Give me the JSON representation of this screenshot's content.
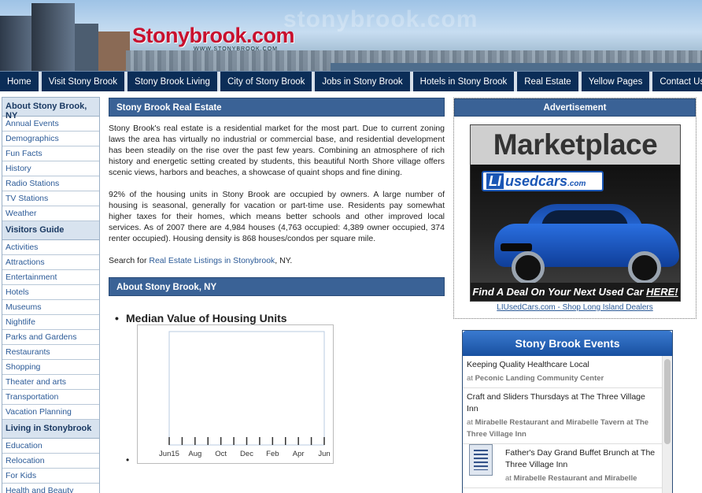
{
  "header": {
    "logo_text": "Stonybrook.com",
    "logo_sub": "WWW.STONYBROOK.COM",
    "watermark": "stonybrook.com"
  },
  "nav": [
    "Home",
    "Visit Stony Brook",
    "Stony Brook Living",
    "City of Stony Brook",
    "Jobs in Stony Brook",
    "Hotels in Stony Brook",
    "Real Estate",
    "Yellow Pages",
    "Contact Us"
  ],
  "sidebar": {
    "about_head": "About Stony Brook, NY",
    "about_items": [
      "Annual Events",
      "Demographics",
      "Fun Facts",
      "History",
      "Radio Stations",
      "TV Stations",
      "Weather"
    ],
    "visitors_head": "Visitors Guide",
    "visitors_items": [
      "Activities",
      "Attractions",
      "Entertainment",
      "Hotels",
      "Museums",
      "Nightlife",
      "Parks and Gardens",
      "Restaurants",
      "Shopping",
      "Theater and arts",
      "Transportation",
      "Vacation Planning"
    ],
    "living_head": "Living in Stonybrook",
    "living_items": [
      "Education",
      "Relocation",
      "For Kids",
      "Health and Beauty"
    ]
  },
  "main": {
    "section_title": "Stony Brook Real Estate",
    "p1": "Stony Brook's real estate is a residential market for the most part. Due to current zoning laws the area has virtually no industrial or commercial base, and residential development has been steadily on the rise over the past few years. Combining an atmosphere of rich history and energetic setting created by students, this beautiful North Shore village offers scenic views, harbors and beaches, a showcase of quaint shops and fine dining.",
    "p2": "92% of the housing units in Stony Brook are occupied by owners. A large number of housing is seasonal, generally for vacation or part-time use. Residents pay somewhat higher taxes for their homes, which means better schools and other improved local services. As of 2007 there are 4,984 houses (4,763 occupied: 4,389 owner occupied, 374 renter occupied). Housing density is 868 houses/condos per square mile.",
    "p3_prefix": "Search for ",
    "p3_link": "Real Estate Listings in Stonybrook",
    "p3_suffix": ", NY.",
    "about_title": "About Stony Brook, NY",
    "chart_heading": "Median Value of Housing Units"
  },
  "chart_data": {
    "type": "bar",
    "title": "Median Value of Housing Units",
    "categories": [
      "Jun15",
      "Aug",
      "Oct",
      "Dec",
      "Feb",
      "Apr",
      "Jun"
    ],
    "series": [],
    "grid": false
  },
  "ad": {
    "title": "Advertisement",
    "headline": "Marketplace",
    "brand_li": "LI",
    "brand_rest": "usedcars",
    "brand_com": ".com",
    "tagline_prefix": "Find A Deal On Your Next Used Car ",
    "tagline_link": "HERE!",
    "caption": "LIUsedCars.com - Shop Long Island Dealers"
  },
  "events": {
    "title": "Stony Brook Events",
    "items": [
      {
        "title": "Keeping Quality Healthcare Local",
        "at": "at",
        "venue": "Peconic Landing Community Center"
      },
      {
        "title": "Craft and Sliders Thursdays at The Three Village Inn",
        "at": "at",
        "venue": "Mirabelle Restaurant and Mirabelle Tavern at The Three Village Inn"
      },
      {
        "title": "Father's Day Grand Buffet Brunch at The Three Village Inn",
        "at": "at",
        "venue": "Mirabelle Restaurant and Mirabelle"
      }
    ]
  }
}
